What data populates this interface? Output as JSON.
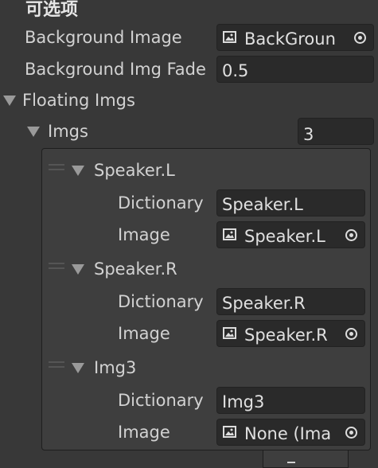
{
  "header": {
    "title": "可选项"
  },
  "background_image": {
    "label": "Background Image",
    "value": "BackGroun",
    "icon": "image-icon"
  },
  "background_fade": {
    "label": "Background Img Fade",
    "value": "0.5"
  },
  "floating_imgs": {
    "label": "Floating Imgs"
  },
  "imgs": {
    "label": "Imgs",
    "count": "3",
    "elements": [
      {
        "name": "Speaker.L",
        "dictionary_label": "Dictionary",
        "dictionary_value": "Speaker.L",
        "image_label": "Image",
        "image_value": "Speaker.L"
      },
      {
        "name": "Speaker.R",
        "dictionary_label": "Dictionary",
        "dictionary_value": "Speaker.R",
        "image_label": "Image",
        "image_value": "Speaker.R"
      },
      {
        "name": "Img3",
        "dictionary_label": "Dictionary",
        "dictionary_value": "Img3",
        "image_label": "Image",
        "image_value": "None (Ima"
      }
    ]
  },
  "colors": {
    "background": "#383838",
    "field": "#2a2a2a",
    "text": "#d2d2d2",
    "list_background": "#3e3e3e"
  }
}
